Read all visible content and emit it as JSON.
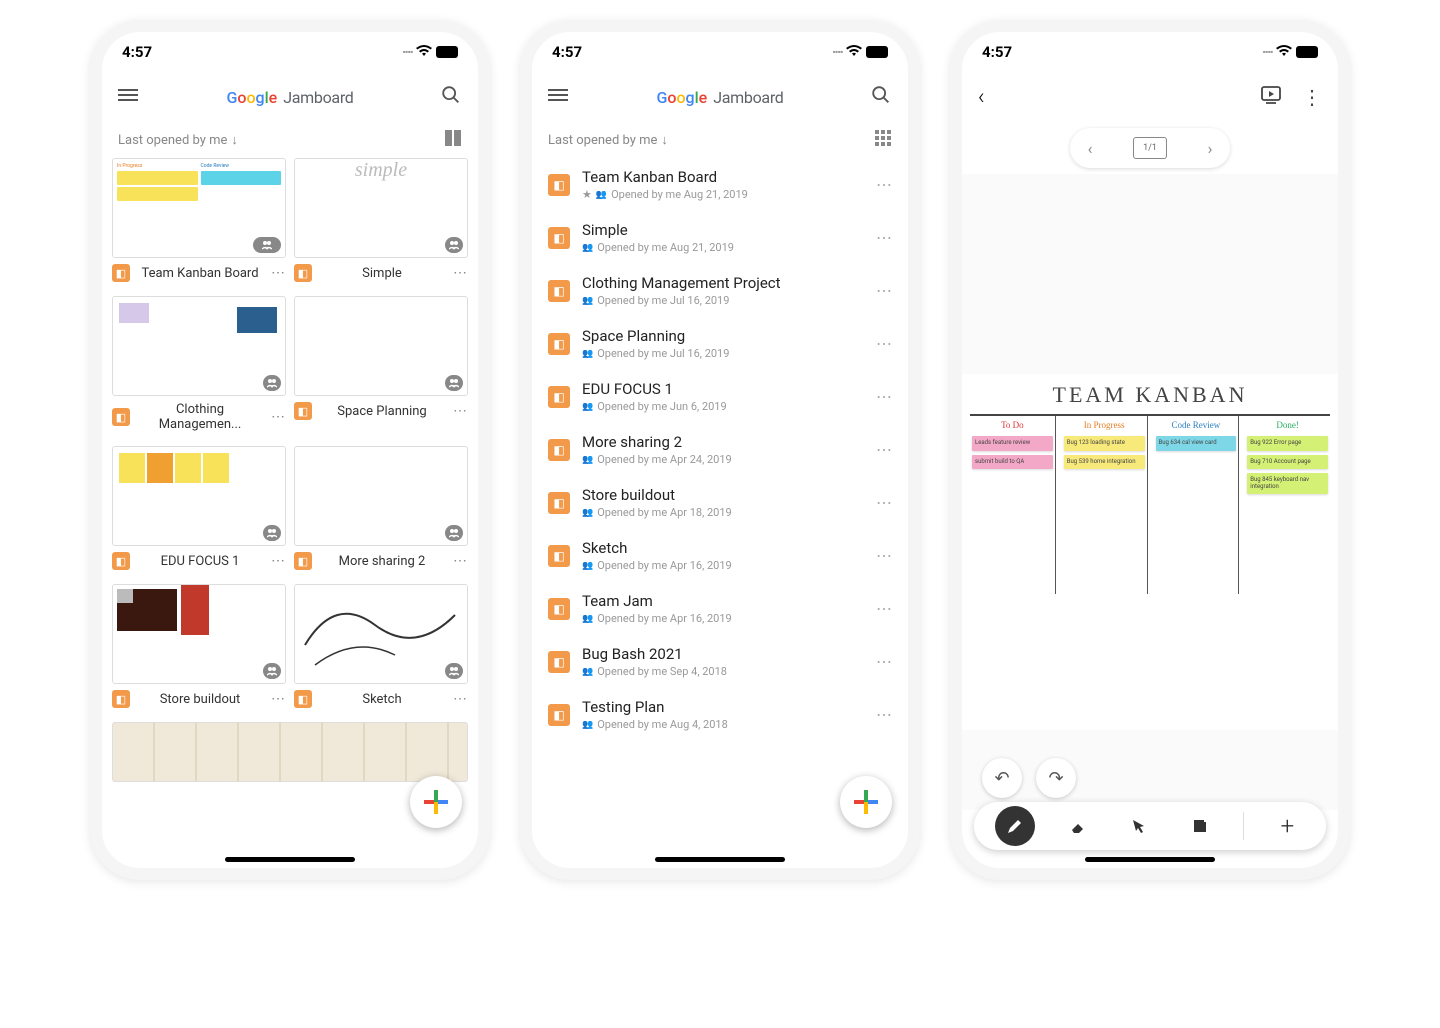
{
  "status": {
    "time": "4:57"
  },
  "app": {
    "jamboard_label": "Jamboard"
  },
  "sort": {
    "label": "Last opened by me",
    "arrow": "↓"
  },
  "grid_items": [
    {
      "title": "Team Kanban Board"
    },
    {
      "title": "Simple"
    },
    {
      "title": "Clothing Managemen..."
    },
    {
      "title": "Space Planning"
    },
    {
      "title": "EDU FOCUS 1"
    },
    {
      "title": "More sharing 2"
    },
    {
      "title": "Store buildout"
    },
    {
      "title": "Sketch"
    }
  ],
  "list_items": [
    {
      "title": "Team Kanban Board",
      "sub": "Opened by me Aug 21, 2019",
      "starred": true
    },
    {
      "title": "Simple",
      "sub": "Opened by me Aug 21, 2019"
    },
    {
      "title": "Clothing Management Project",
      "sub": "Opened by me Jul 16, 2019"
    },
    {
      "title": "Space Planning",
      "sub": "Opened by me Jul 16, 2019"
    },
    {
      "title": "EDU FOCUS 1",
      "sub": "Opened by me Jun 6, 2019"
    },
    {
      "title": "More sharing 2",
      "sub": "Opened by me Apr 24, 2019"
    },
    {
      "title": "Store buildout",
      "sub": "Opened by me Apr 18, 2019"
    },
    {
      "title": "Sketch",
      "sub": "Opened by me Apr 16, 2019"
    },
    {
      "title": "Team Jam",
      "sub": "Opened by me Apr 16, 2019"
    },
    {
      "title": "Bug Bash 2021",
      "sub": "Opened by me Sep 4, 2018"
    },
    {
      "title": "Testing Plan",
      "sub": "Opened by me Aug 4, 2018"
    }
  ],
  "editor": {
    "frame_label": "1/1",
    "board_title": "TEAM  KANBAN",
    "columns": [
      {
        "header": "To Do",
        "color": "red",
        "notes": [
          {
            "cls": "pink",
            "t": "Leads feature review"
          },
          {
            "cls": "pink",
            "t": "submit build to QA"
          }
        ]
      },
      {
        "header": "In Progress",
        "color": "orange",
        "notes": [
          {
            "cls": "yellow",
            "t": "Bug 123 loading state"
          },
          {
            "cls": "yellow",
            "t": "Bug 539 home integration"
          }
        ]
      },
      {
        "header": "Code Review",
        "color": "blue",
        "notes": [
          {
            "cls": "cyan",
            "t": "Bug 634 cal view card"
          }
        ]
      },
      {
        "header": "Done!",
        "color": "green",
        "notes": [
          {
            "cls": "green",
            "t": "Bug 922 Error page"
          },
          {
            "cls": "green",
            "t": "Bug 710 Account page"
          },
          {
            "cls": "green",
            "t": "Bug 845 keyboard nav integration"
          }
        ]
      }
    ]
  }
}
